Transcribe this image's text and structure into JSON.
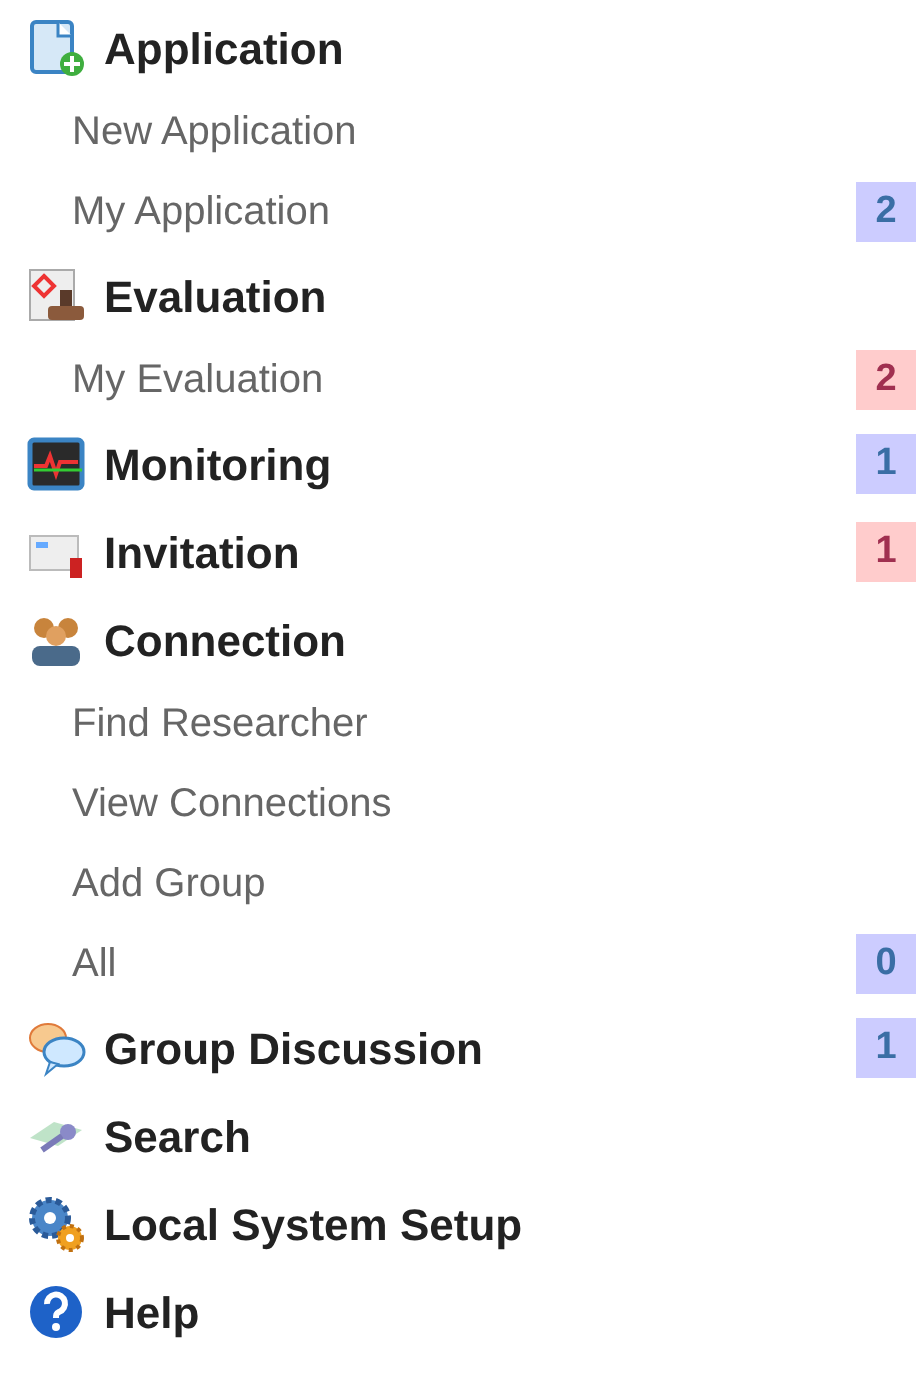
{
  "menu": [
    {
      "label": "Application",
      "children": [
        {
          "label": "New Application"
        },
        {
          "label": "My Application",
          "badge": {
            "text": "2",
            "color": "#ccccff"
          }
        }
      ]
    },
    {
      "label": "Evaluation",
      "children": [
        {
          "label": "My Evaluation",
          "badge": {
            "text": "2",
            "color": "#ffcccc"
          }
        }
      ]
    },
    {
      "label": "Monitoring",
      "badge": {
        "text": "1",
        "color": "#ccccff"
      }
    },
    {
      "label": "Invitation",
      "badge": {
        "text": "1",
        "color": "#ffcccc"
      }
    },
    {
      "label": "Connection",
      "children": [
        {
          "label": "Find Researcher"
        },
        {
          "label": "View Connections"
        },
        {
          "label": "Add Group"
        },
        {
          "label": "All",
          "badge": {
            "text": "0",
            "color": "#ccccff"
          }
        }
      ]
    },
    {
      "label": "Group Discussion",
      "badge": {
        "text": "1",
        "color": "#ccccff"
      }
    },
    {
      "label": "Search"
    },
    {
      "label": "Local System Setup"
    },
    {
      "label": "Help"
    }
  ]
}
